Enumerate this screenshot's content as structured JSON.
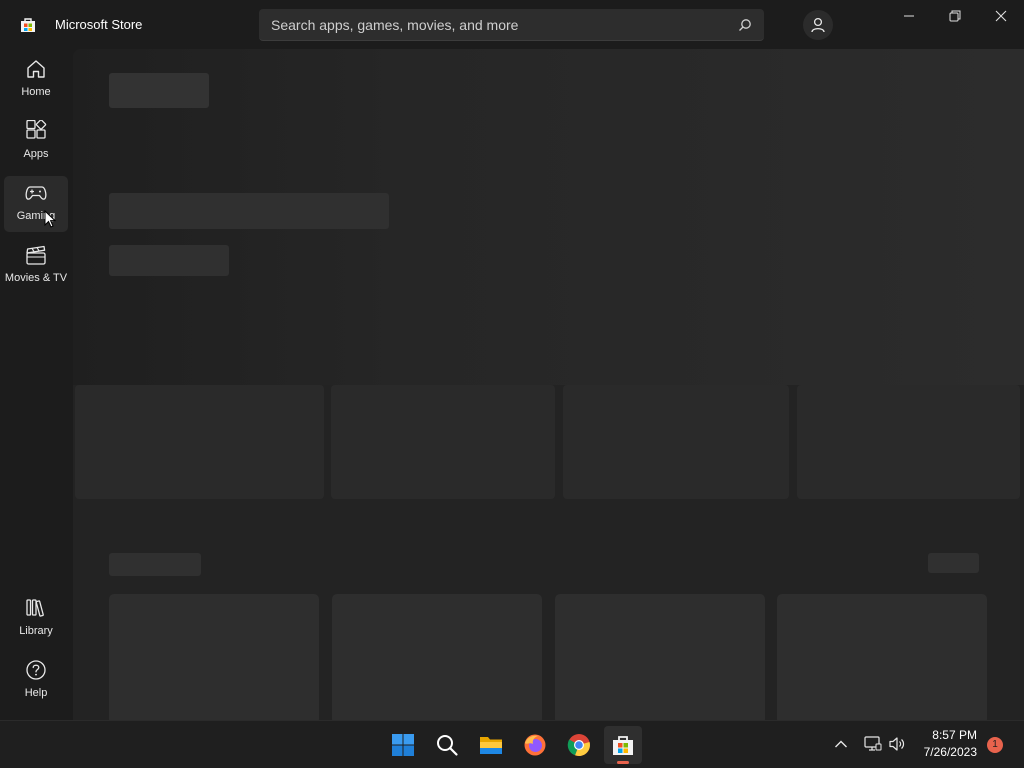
{
  "app": {
    "title": "Microsoft Store",
    "brand_colors": [
      "#f25022",
      "#7fba00",
      "#00a4ef",
      "#ffb900"
    ]
  },
  "search": {
    "placeholder": "Search apps, games, movies, and more",
    "icon": "search-icon"
  },
  "window_controls": {
    "minimize_icon": "minimize-icon",
    "restore_icon": "restore-icon",
    "close_icon": "close-icon"
  },
  "sidebar": {
    "items": [
      {
        "label": "Home",
        "icon": "home-icon"
      },
      {
        "label": "Apps",
        "icon": "apps-icon"
      },
      {
        "label": "Gaming",
        "icon": "gamepad-icon",
        "active": true
      },
      {
        "label": "Movies & TV",
        "icon": "clapperboard-icon"
      }
    ],
    "bottom_items": [
      {
        "label": "Library",
        "icon": "library-icon"
      },
      {
        "label": "Help",
        "icon": "help-icon"
      }
    ]
  },
  "content": {
    "state": "loading"
  },
  "taskbar": {
    "apps": [
      {
        "name": "Start",
        "icon": "windows-start-icon"
      },
      {
        "name": "Search",
        "icon": "search-icon"
      },
      {
        "name": "File Explorer",
        "icon": "folder-icon"
      },
      {
        "name": "Firefox",
        "icon": "firefox-icon"
      },
      {
        "name": "Chrome",
        "icon": "chrome-icon"
      },
      {
        "name": "Microsoft Store",
        "icon": "store-icon",
        "active": true
      }
    ],
    "accent_color": "#e8634d",
    "clock": {
      "time": "8:57 PM",
      "date": "7/26/2023"
    },
    "notification_count": "1"
  }
}
